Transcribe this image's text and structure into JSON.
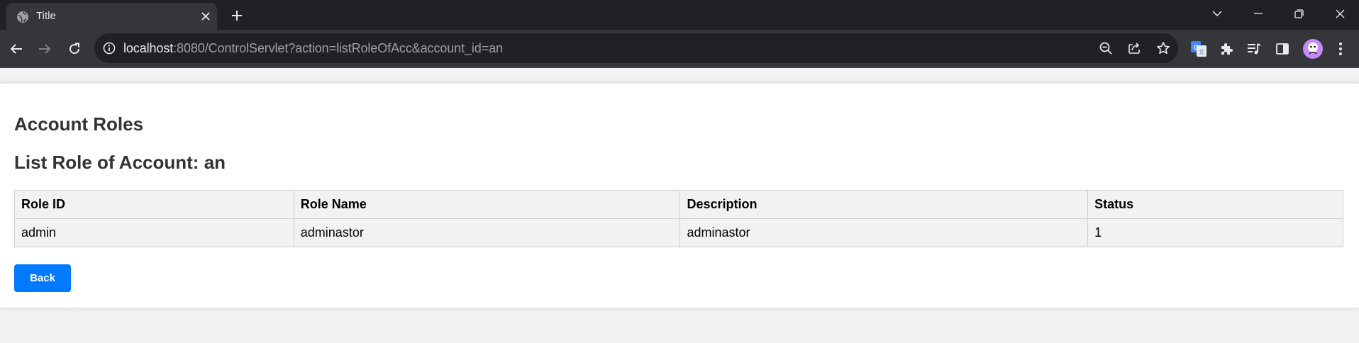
{
  "browser": {
    "tab_title": "Title",
    "url_host": "localhost",
    "url_rest": ":8080/ControlServlet?action=listRoleOfAcc&account_id=an",
    "icons": [
      "globe-icon",
      "close-icon",
      "plus-icon",
      "chevron-down-icon",
      "minimize-icon",
      "restore-icon",
      "close-window-icon",
      "back-arrow-icon",
      "forward-arrow-icon",
      "reload-icon",
      "info-icon",
      "zoom-out-icon",
      "share-icon",
      "star-icon",
      "translate-icon",
      "puzzle-icon",
      "media-icon",
      "side-panel-icon",
      "profile-avatar",
      "kebab-menu-icon"
    ],
    "accent_colors": {
      "tabbar": "#202124",
      "toolbar": "#35363a",
      "avatar": "#c58af9"
    }
  },
  "page": {
    "title": "Account Roles",
    "subtitle": "List Role of Account: an",
    "table": {
      "headers": [
        "Role ID",
        "Role Name",
        "Description",
        "Status"
      ],
      "rows": [
        [
          "admin",
          "adminastor",
          "adminastor",
          "1"
        ]
      ]
    },
    "back_label": "Back",
    "accent_color": "#007bff"
  }
}
